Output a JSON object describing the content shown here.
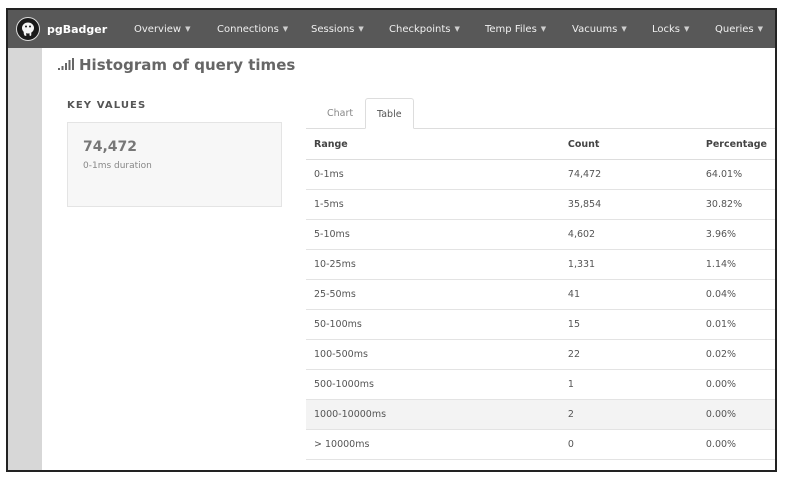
{
  "navbar": {
    "brand": "pgBadger",
    "items": [
      {
        "label": "Overview"
      },
      {
        "label": "Connections"
      },
      {
        "label": "Sessions"
      },
      {
        "label": "Checkpoints"
      },
      {
        "label": "Temp Files"
      },
      {
        "label": "Vacuums"
      },
      {
        "label": "Locks"
      },
      {
        "label": "Queries"
      }
    ]
  },
  "page": {
    "title": "Histogram of query times",
    "title_icon": "bar-chart-icon"
  },
  "key_values": {
    "heading": "KEY VALUES",
    "value": "74,472",
    "label": "0-1ms duration"
  },
  "tabs": [
    {
      "label": "Chart",
      "active": false
    },
    {
      "label": "Table",
      "active": true
    }
  ],
  "table": {
    "headers": [
      "Range",
      "Count",
      "Percentage"
    ],
    "rows": [
      {
        "range": "0-1ms",
        "count": "74,472",
        "pct": "64.01%"
      },
      {
        "range": "1-5ms",
        "count": "35,854",
        "pct": "30.82%"
      },
      {
        "range": "5-10ms",
        "count": "4,602",
        "pct": "3.96%"
      },
      {
        "range": "10-25ms",
        "count": "1,331",
        "pct": "1.14%"
      },
      {
        "range": "25-50ms",
        "count": "41",
        "pct": "0.04%"
      },
      {
        "range": "50-100ms",
        "count": "15",
        "pct": "0.01%"
      },
      {
        "range": "100-500ms",
        "count": "22",
        "pct": "0.02%"
      },
      {
        "range": "500-1000ms",
        "count": "1",
        "pct": "0.00%"
      },
      {
        "range": "1000-10000ms",
        "count": "2",
        "pct": "0.00%"
      },
      {
        "range": "> 10000ms",
        "count": "0",
        "pct": "0.00%"
      }
    ]
  },
  "colors": {
    "navbar_bg": "#585858",
    "sidebar_bg": "#d7d7d7",
    "highlight_row": "#f3f3f3"
  }
}
